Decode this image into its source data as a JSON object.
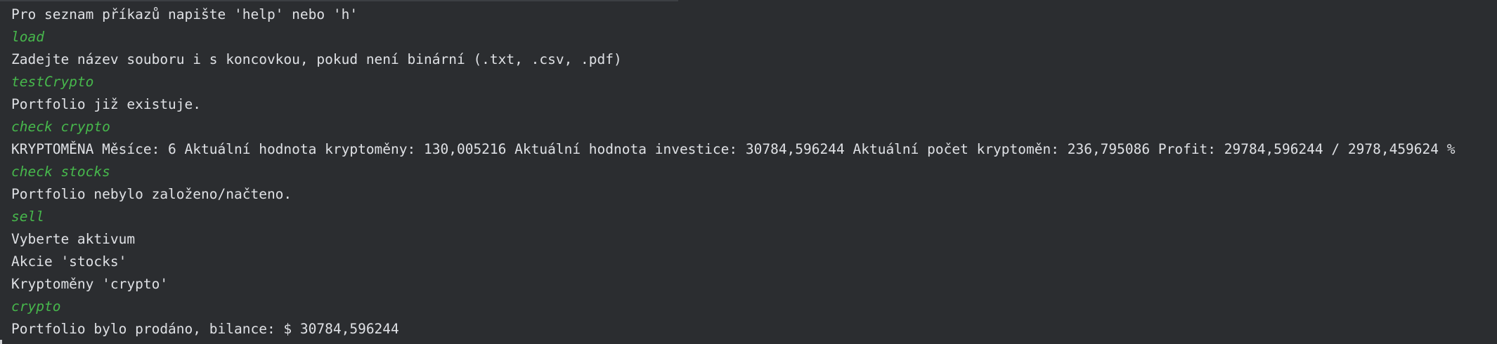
{
  "console": {
    "lines": [
      {
        "text": "Pro seznam příkazů napište 'help' nebo 'h'",
        "kind": "output"
      },
      {
        "text": "load",
        "kind": "input"
      },
      {
        "text": "Zadejte název souboru i s koncovkou, pokud není binární (.txt, .csv, .pdf)",
        "kind": "output"
      },
      {
        "text": "testCrypto",
        "kind": "input"
      },
      {
        "text": "Portfolio již existuje.",
        "kind": "output"
      },
      {
        "text": "check crypto",
        "kind": "input"
      },
      {
        "text": "KRYPTOMĚNA Měsíce: 6 Aktuální hodnota kryptoměny: 130,005216 Aktuální hodnota investice: 30784,596244 Aktuální počet kryptoměn: 236,795086 Profit: 29784,596244 / 2978,459624 %",
        "kind": "output"
      },
      {
        "text": "check stocks",
        "kind": "input"
      },
      {
        "text": "Portfolio nebylo založeno/načteno.",
        "kind": "output"
      },
      {
        "text": "sell",
        "kind": "input"
      },
      {
        "text": "Vyberte aktivum",
        "kind": "output"
      },
      {
        "text": "Akcie 'stocks'",
        "kind": "output"
      },
      {
        "text": "Kryptoměny 'crypto'",
        "kind": "output"
      },
      {
        "text": "crypto",
        "kind": "input"
      },
      {
        "text": "Portfolio bylo prodáno, bilance: $ 30784,596244",
        "kind": "output"
      }
    ]
  },
  "colors": {
    "background": "#2b2d30",
    "output_text": "#dfe1e5",
    "user_input_text": "#47b84c"
  }
}
